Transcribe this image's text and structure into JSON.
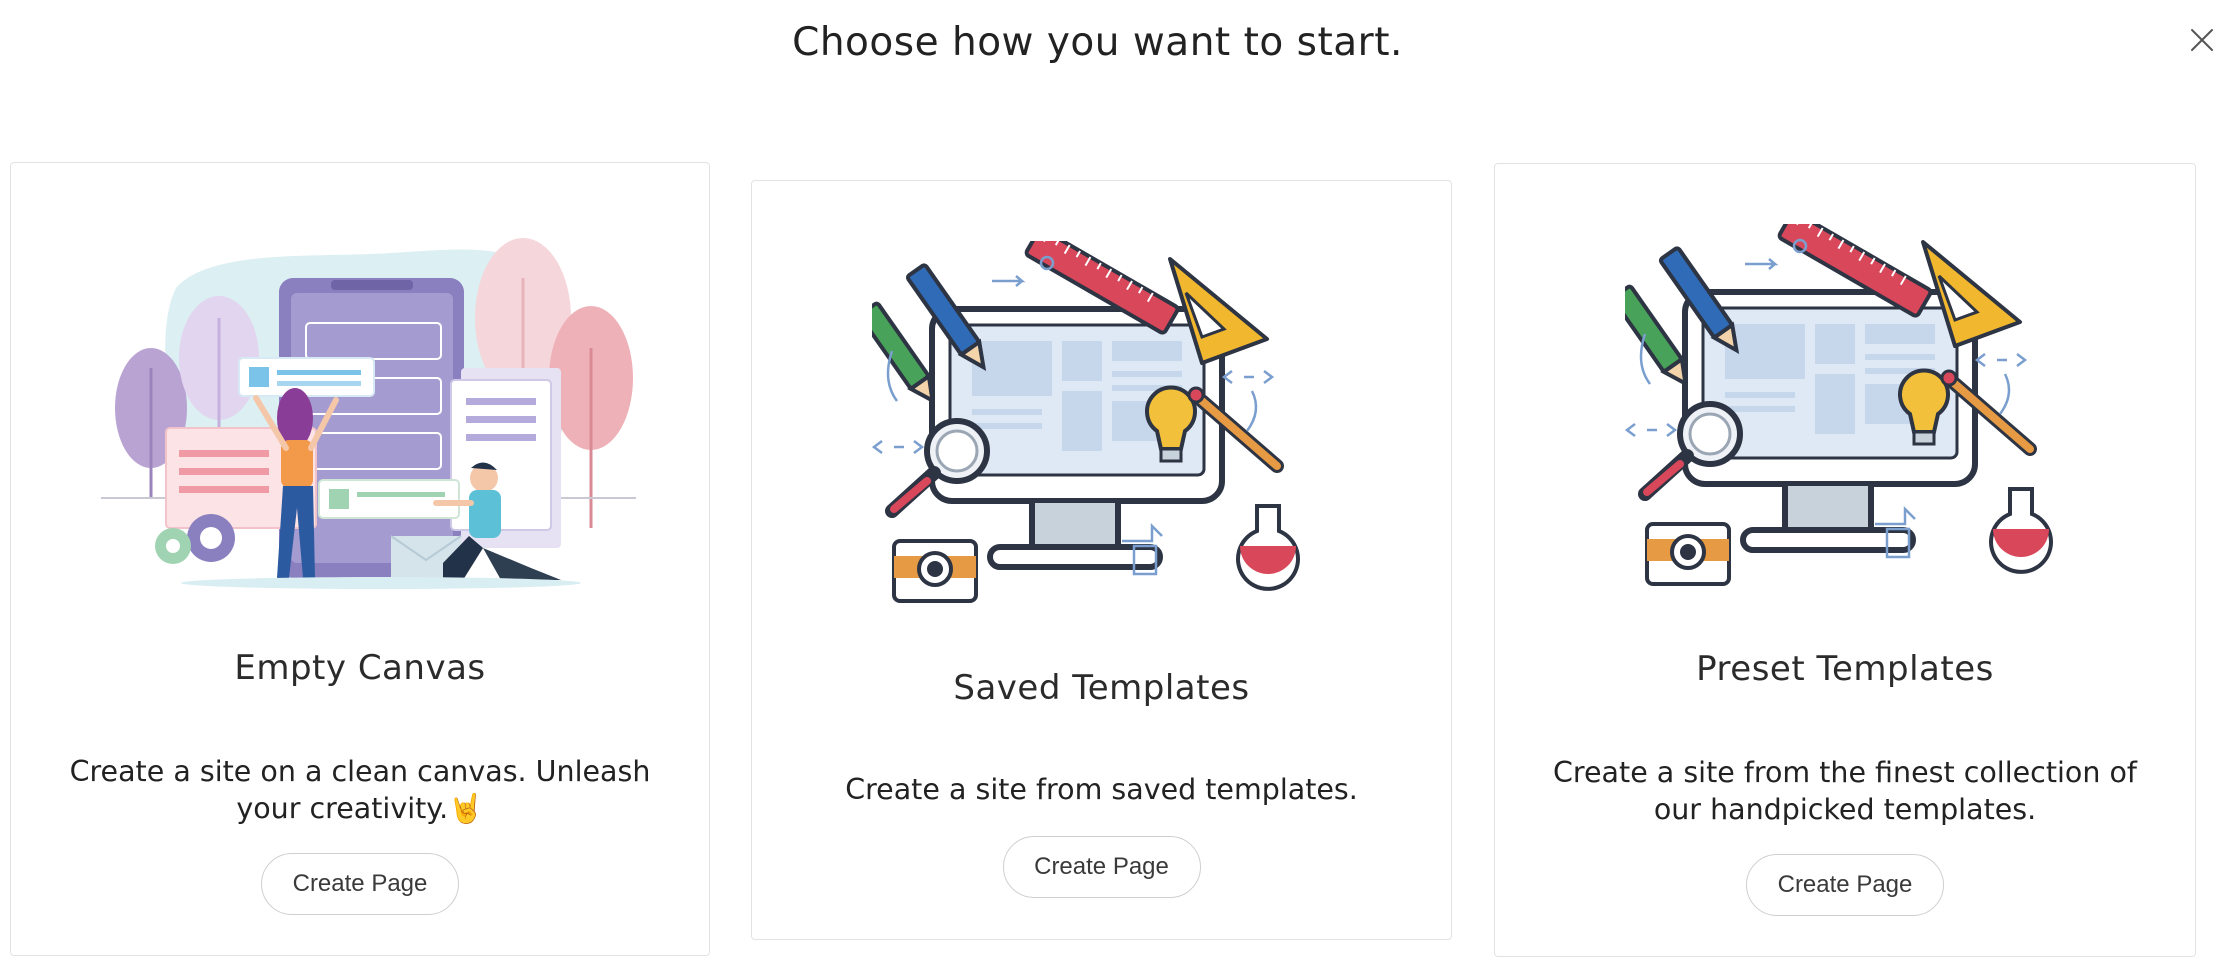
{
  "header": {
    "title": "Choose how you want to start.",
    "close_icon": "close-icon"
  },
  "cards": [
    {
      "title": "Empty Canvas",
      "description": "Create a site on a clean canvas. Unleash your creativity.",
      "emoji": "🤘",
      "button": "Create Page",
      "illustration": "people-building-website-illustration"
    },
    {
      "title": "Saved Templates",
      "description": "Create a site from saved templates.",
      "button": "Create Page",
      "illustration": "monitor-design-tools-illustration"
    },
    {
      "title": "Preset Templates",
      "description": "Create a site from the finest collection of our handpicked templates.",
      "button": "Create Page",
      "illustration": "monitor-design-tools-illustration"
    }
  ],
  "colors": {
    "card_border": "#e3e3e6",
    "button_border": "#cfcfd3",
    "text": "#222222"
  }
}
